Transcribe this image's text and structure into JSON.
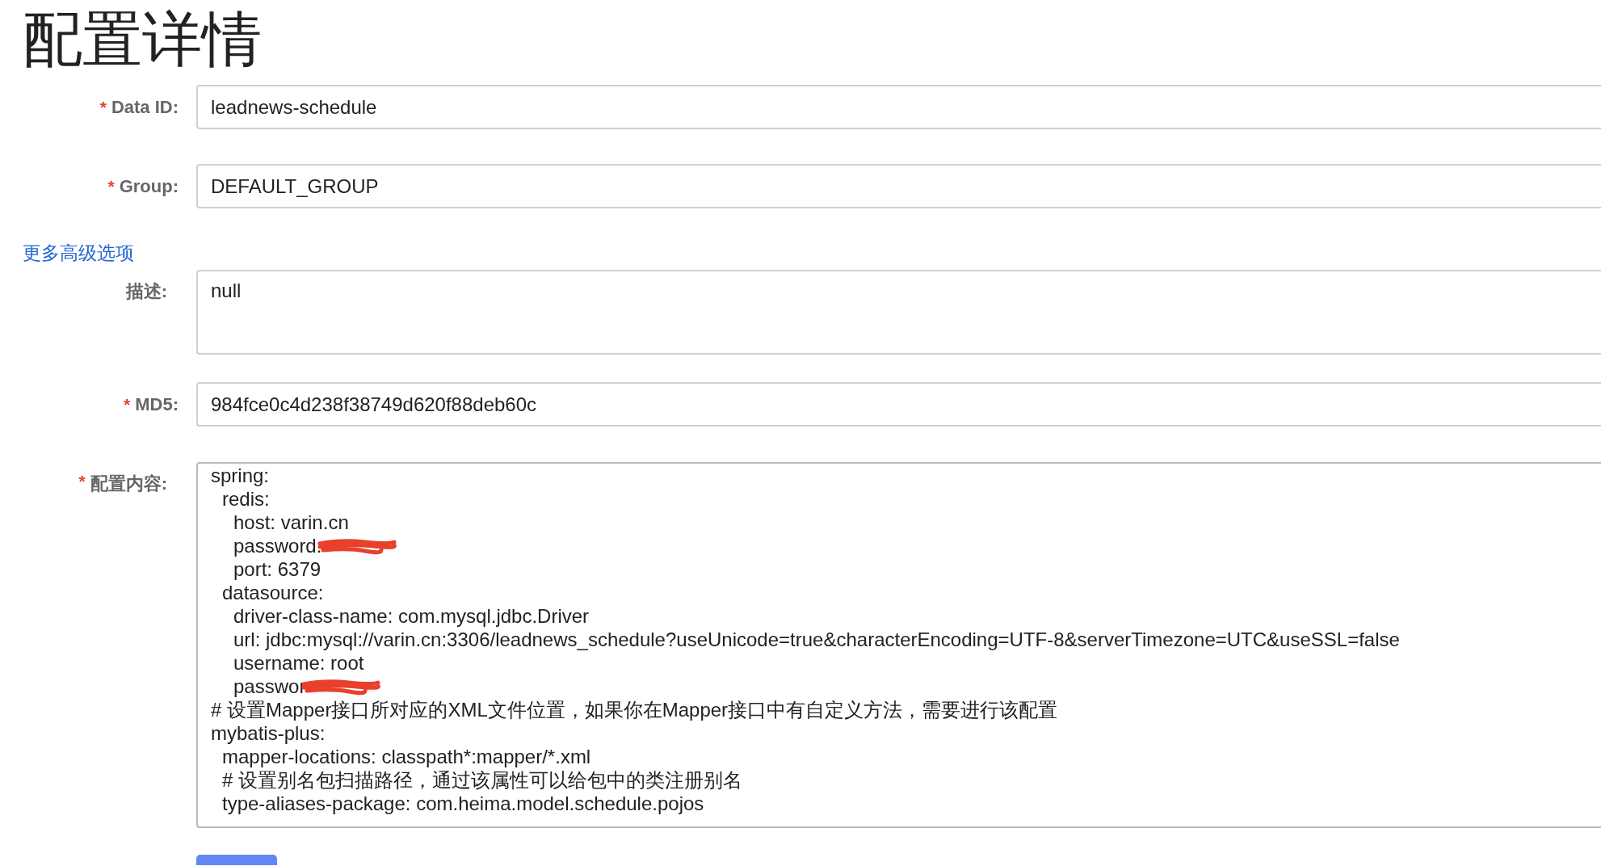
{
  "title": "配置详情",
  "fields_top": [
    {
      "mark": "*",
      "label": "Data ID:",
      "value": "leadnews-schedule"
    },
    {
      "mark": "*",
      "label": "Group:",
      "value": "DEFAULT_GROUP"
    }
  ],
  "advanced_link": "更多高级选项",
  "description": {
    "label": "描述:",
    "value": "null"
  },
  "md5": {
    "mark": "*",
    "label": "MD5:",
    "value": "984fce0c4d238f38749d620f88deb60c"
  },
  "content": {
    "mark": "*",
    "label": "配置内容:",
    "lines": [
      {
        "text": "spring:",
        "redacted": false,
        "children": [
          {
            "text": "redis:",
            "redacted": false,
            "children": [
              {
                "text": "host: varin.cn",
                "redacted": false
              },
              {
                "text": "password:",
                "redacted": true
              },
              {
                "text": "port: 6379",
                "redacted": false
              }
            ]
          },
          {
            "text": "datasource:",
            "redacted": false,
            "children": [
              {
                "text": "driver-class-name: com.mysql.jdbc.Driver",
                "redacted": false
              },
              {
                "text": "url: jdbc:mysql://varin.cn:3306/leadnews_schedule?useUnicode=true&characterEncoding=UTF-8&serverTimezone=UTC&useSSL=false",
                "redacted": false
              },
              {
                "text": "username: root",
                "redacted": false
              },
              {
                "text": "passwor",
                "redacted": true
              }
            ]
          }
        ]
      },
      {
        "text": "# 设置Mapper接口所对应的XML文件位置，如果你在Mapper接口中有自定义方法，需要进行该配置",
        "redacted": false
      },
      {
        "text": "mybatis-plus:",
        "redacted": false,
        "children": [
          {
            "text": "mapper-locations: classpath*:mapper/*.xml",
            "redacted": false
          },
          {
            "text": "# 设置别名包扫描路径，通过该属性可以给包中的类注册别名",
            "redacted": false
          },
          {
            "text": "type-aliases-package: com.heima.model.schedule.pojos",
            "redacted": false
          }
        ]
      }
    ]
  }
}
